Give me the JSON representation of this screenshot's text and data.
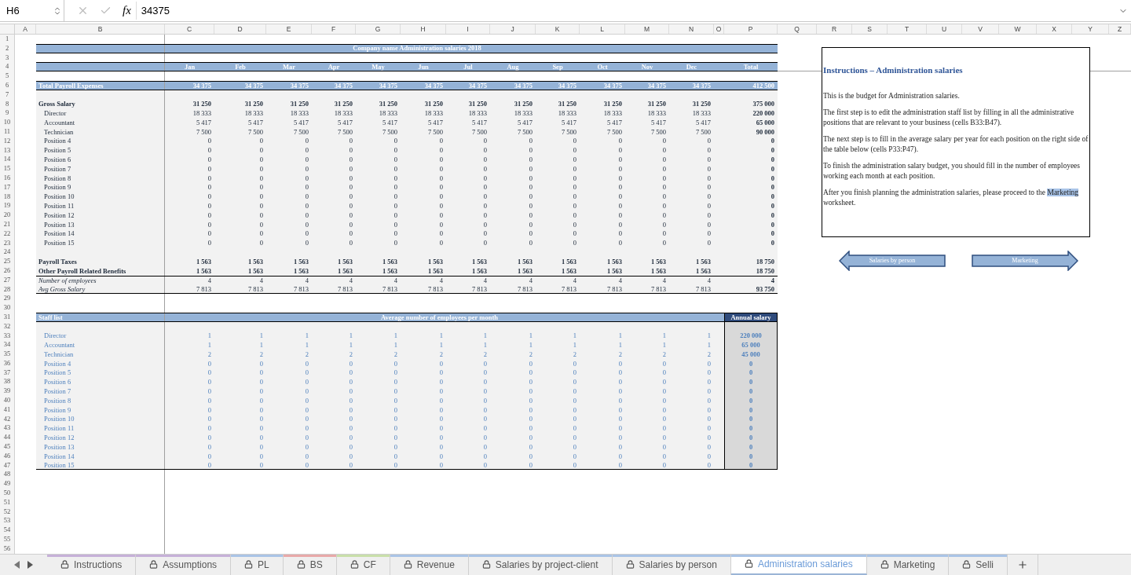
{
  "formula_bar": {
    "cell_ref": "H6",
    "function_label": "fx",
    "formula": "34375"
  },
  "columns": [
    "A",
    "B",
    "C",
    "D",
    "E",
    "F",
    "G",
    "H",
    "I",
    "J",
    "K",
    "L",
    "M",
    "N",
    "O",
    "P",
    "Q",
    "R",
    "S",
    "T",
    "U",
    "V",
    "W",
    "X",
    "Y",
    "Z"
  ],
  "row_numbers": [
    "1",
    "2",
    "3",
    "4",
    "5",
    "6",
    "7",
    "8",
    "9",
    "10",
    "11",
    "12",
    "13",
    "14",
    "15",
    "16",
    "17",
    "18",
    "19",
    "20",
    "21",
    "22",
    "23",
    "24",
    "25",
    "26",
    "27",
    "28",
    "29",
    "30",
    "31",
    "32",
    "33",
    "34",
    "35",
    "36",
    "37",
    "38",
    "39",
    "40",
    "41",
    "42",
    "43",
    "44",
    "45",
    "46",
    "47",
    "48",
    "49",
    "50",
    "51",
    "52",
    "53",
    "54",
    "55",
    "56"
  ],
  "sheet": {
    "title": "Company name Administration salaries 2018",
    "months": [
      "Jan",
      "Feb",
      "Mar",
      "Apr",
      "May",
      "Jun",
      "Jul",
      "Aug",
      "Sep",
      "Oct",
      "Nov",
      "Dec"
    ],
    "total_header": "Total",
    "total_row": {
      "label": "Total Payroll Expenses",
      "values": [
        "34 375",
        "34 375",
        "34 375",
        "34 375",
        "34 375",
        "34 375",
        "34 375",
        "34 375",
        "34 375",
        "34 375",
        "34 375",
        "34 375"
      ],
      "total": "412 500"
    },
    "salary_lines": [
      {
        "kind": "bold",
        "label": "Gross Salary",
        "values": [
          "31 250",
          "31 250",
          "31 250",
          "31 250",
          "31 250",
          "31 250",
          "31 250",
          "31 250",
          "31 250",
          "31 250",
          "31 250",
          "31 250"
        ],
        "total": "375 000"
      },
      {
        "kind": "indent",
        "label": "Director",
        "values": [
          "18 333",
          "18 333",
          "18 333",
          "18 333",
          "18 333",
          "18 333",
          "18 333",
          "18 333",
          "18 333",
          "18 333",
          "18 333",
          "18 333"
        ],
        "total": "220 000"
      },
      {
        "kind": "indent",
        "label": "Accountant",
        "values": [
          "5 417",
          "5 417",
          "5 417",
          "5 417",
          "5 417",
          "5 417",
          "5 417",
          "5 417",
          "5 417",
          "5 417",
          "5 417",
          "5 417"
        ],
        "total": "65 000"
      },
      {
        "kind": "indent",
        "label": "Technician",
        "values": [
          "7 500",
          "7 500",
          "7 500",
          "7 500",
          "7 500",
          "7 500",
          "7 500",
          "7 500",
          "7 500",
          "7 500",
          "7 500",
          "7 500"
        ],
        "total": "90 000"
      },
      {
        "kind": "indent",
        "label": "Position 4",
        "values": [
          "0",
          "0",
          "0",
          "0",
          "0",
          "0",
          "0",
          "0",
          "0",
          "0",
          "0",
          "0"
        ],
        "total": "0"
      },
      {
        "kind": "indent",
        "label": "Position 5",
        "values": [
          "0",
          "0",
          "0",
          "0",
          "0",
          "0",
          "0",
          "0",
          "0",
          "0",
          "0",
          "0"
        ],
        "total": "0"
      },
      {
        "kind": "indent",
        "label": "Position 6",
        "values": [
          "0",
          "0",
          "0",
          "0",
          "0",
          "0",
          "0",
          "0",
          "0",
          "0",
          "0",
          "0"
        ],
        "total": "0"
      },
      {
        "kind": "indent",
        "label": "Position 7",
        "values": [
          "0",
          "0",
          "0",
          "0",
          "0",
          "0",
          "0",
          "0",
          "0",
          "0",
          "0",
          "0"
        ],
        "total": "0"
      },
      {
        "kind": "indent",
        "label": "Position 8",
        "values": [
          "0",
          "0",
          "0",
          "0",
          "0",
          "0",
          "0",
          "0",
          "0",
          "0",
          "0",
          "0"
        ],
        "total": "0"
      },
      {
        "kind": "indent",
        "label": "Position 9",
        "values": [
          "0",
          "0",
          "0",
          "0",
          "0",
          "0",
          "0",
          "0",
          "0",
          "0",
          "0",
          "0"
        ],
        "total": "0"
      },
      {
        "kind": "indent",
        "label": "Position 10",
        "values": [
          "0",
          "0",
          "0",
          "0",
          "0",
          "0",
          "0",
          "0",
          "0",
          "0",
          "0",
          "0"
        ],
        "total": "0"
      },
      {
        "kind": "indent",
        "label": "Position 11",
        "values": [
          "0",
          "0",
          "0",
          "0",
          "0",
          "0",
          "0",
          "0",
          "0",
          "0",
          "0",
          "0"
        ],
        "total": "0"
      },
      {
        "kind": "indent",
        "label": "Position 12",
        "values": [
          "0",
          "0",
          "0",
          "0",
          "0",
          "0",
          "0",
          "0",
          "0",
          "0",
          "0",
          "0"
        ],
        "total": "0"
      },
      {
        "kind": "indent",
        "label": "Position 13",
        "values": [
          "0",
          "0",
          "0",
          "0",
          "0",
          "0",
          "0",
          "0",
          "0",
          "0",
          "0",
          "0"
        ],
        "total": "0"
      },
      {
        "kind": "indent",
        "label": "Position 14",
        "values": [
          "0",
          "0",
          "0",
          "0",
          "0",
          "0",
          "0",
          "0",
          "0",
          "0",
          "0",
          "0"
        ],
        "total": "0"
      },
      {
        "kind": "indent",
        "label": "Position 15",
        "values": [
          "0",
          "0",
          "0",
          "0",
          "0",
          "0",
          "0",
          "0",
          "0",
          "0",
          "0",
          "0"
        ],
        "total": "0"
      }
    ],
    "summary_lines": [
      {
        "kind": "bold",
        "label": "Payroll Taxes",
        "values": [
          "1 563",
          "1 563",
          "1 563",
          "1 563",
          "1 563",
          "1 563",
          "1 563",
          "1 563",
          "1 563",
          "1 563",
          "1 563",
          "1 563"
        ],
        "total": "18 750"
      },
      {
        "kind": "bold",
        "label": "Other Payroll Related Benefits",
        "values": [
          "1 563",
          "1 563",
          "1 563",
          "1 563",
          "1 563",
          "1 563",
          "1 563",
          "1 563",
          "1 563",
          "1 563",
          "1 563",
          "1 563"
        ],
        "total": "18 750"
      },
      {
        "kind": "italic",
        "label": "Number of employees",
        "values": [
          "4",
          "4",
          "4",
          "4",
          "4",
          "4",
          "4",
          "4",
          "4",
          "4",
          "4",
          "4"
        ],
        "total": "4"
      },
      {
        "kind": "italic",
        "label": "Avg Gross Salary",
        "values": [
          "7 813",
          "7 813",
          "7 813",
          "7 813",
          "7 813",
          "7 813",
          "7 813",
          "7 813",
          "7 813",
          "7 813",
          "7 813",
          "7 813"
        ],
        "total": "93 750"
      }
    ],
    "staff": {
      "title": "Staff list",
      "subtitle": "Average number of employees per month",
      "total_header": "Annual salary",
      "rows": [
        {
          "label": "Director",
          "values": [
            "1",
            "1",
            "1",
            "1",
            "1",
            "1",
            "1",
            "1",
            "1",
            "1",
            "1",
            "1"
          ],
          "total": "220 000"
        },
        {
          "label": "Accountant",
          "values": [
            "1",
            "1",
            "1",
            "1",
            "1",
            "1",
            "1",
            "1",
            "1",
            "1",
            "1",
            "1"
          ],
          "total": "65 000"
        },
        {
          "label": "Technician",
          "values": [
            "2",
            "2",
            "2",
            "2",
            "2",
            "2",
            "2",
            "2",
            "2",
            "2",
            "2",
            "2"
          ],
          "total": "45 000"
        },
        {
          "label": "Position 4",
          "values": [
            "0",
            "0",
            "0",
            "0",
            "0",
            "0",
            "0",
            "0",
            "0",
            "0",
            "0",
            "0"
          ],
          "total": "0"
        },
        {
          "label": "Position 5",
          "values": [
            "0",
            "0",
            "0",
            "0",
            "0",
            "0",
            "0",
            "0",
            "0",
            "0",
            "0",
            "0"
          ],
          "total": "0"
        },
        {
          "label": "Position 6",
          "values": [
            "0",
            "0",
            "0",
            "0",
            "0",
            "0",
            "0",
            "0",
            "0",
            "0",
            "0",
            "0"
          ],
          "total": "0"
        },
        {
          "label": "Position 7",
          "values": [
            "0",
            "0",
            "0",
            "0",
            "0",
            "0",
            "0",
            "0",
            "0",
            "0",
            "0",
            "0"
          ],
          "total": "0"
        },
        {
          "label": "Position 8",
          "values": [
            "0",
            "0",
            "0",
            "0",
            "0",
            "0",
            "0",
            "0",
            "0",
            "0",
            "0",
            "0"
          ],
          "total": "0"
        },
        {
          "label": "Position 9",
          "values": [
            "0",
            "0",
            "0",
            "0",
            "0",
            "0",
            "0",
            "0",
            "0",
            "0",
            "0",
            "0"
          ],
          "total": "0"
        },
        {
          "label": "Position 10",
          "values": [
            "0",
            "0",
            "0",
            "0",
            "0",
            "0",
            "0",
            "0",
            "0",
            "0",
            "0",
            "0"
          ],
          "total": "0"
        },
        {
          "label": "Position 11",
          "values": [
            "0",
            "0",
            "0",
            "0",
            "0",
            "0",
            "0",
            "0",
            "0",
            "0",
            "0",
            "0"
          ],
          "total": "0"
        },
        {
          "label": "Position 12",
          "values": [
            "0",
            "0",
            "0",
            "0",
            "0",
            "0",
            "0",
            "0",
            "0",
            "0",
            "0",
            "0"
          ],
          "total": "0"
        },
        {
          "label": "Position 13",
          "values": [
            "0",
            "0",
            "0",
            "0",
            "0",
            "0",
            "0",
            "0",
            "0",
            "0",
            "0",
            "0"
          ],
          "total": "0"
        },
        {
          "label": "Position 14",
          "values": [
            "0",
            "0",
            "0",
            "0",
            "0",
            "0",
            "0",
            "0",
            "0",
            "0",
            "0",
            "0"
          ],
          "total": "0"
        },
        {
          "label": "Position 15",
          "values": [
            "0",
            "0",
            "0",
            "0",
            "0",
            "0",
            "0",
            "0",
            "0",
            "0",
            "0",
            "0"
          ],
          "total": "0"
        }
      ]
    }
  },
  "instructions": {
    "title": "Instructions – Administration salaries",
    "paragraphs": [
      "This is the budget for Administration salaries.",
      "The first step is to edit the administration staff list by filling in all the administrative positions that are relevant to your business (cells B33:B47).",
      "The next step is to fill in the average salary per year for each position on the right side of the table below (cells P33:P47).",
      "To finish the administration salary budget, you should fill in the number of employees working each month at each position."
    ],
    "closing": {
      "before": "After you finish planning the administration salaries, please proceed to the ",
      "link": "Marketing",
      "after": " worksheet."
    }
  },
  "nav_arrows": [
    {
      "kind": "left",
      "label": "Salaries by person"
    },
    {
      "kind": "right",
      "label": "Marketing"
    }
  ],
  "tabs": [
    {
      "label": "Instructions",
      "color": "#c6b0d8",
      "selected": false
    },
    {
      "label": "Assumptions",
      "color": "#c6b0d8",
      "selected": false
    },
    {
      "label": "PL",
      "color": "#aac4e6",
      "selected": false
    },
    {
      "label": "BS",
      "color": "#e8a9a9",
      "selected": false
    },
    {
      "label": "CF",
      "color": "#c9dfaa",
      "selected": false
    },
    {
      "label": "Revenue",
      "color": "#aac4e6",
      "selected": false
    },
    {
      "label": "Salaries by project-client",
      "color": "#aac4e6",
      "selected": false
    },
    {
      "label": "Salaries by person",
      "color": "#aac4e6",
      "selected": false
    },
    {
      "label": "Administration salaries",
      "color": "#aac4e6",
      "selected": true
    },
    {
      "label": "Marketing",
      "color": "#aac4e6",
      "selected": false
    },
    {
      "label": "Selli",
      "color": "#aac4e6",
      "selected": false
    }
  ]
}
